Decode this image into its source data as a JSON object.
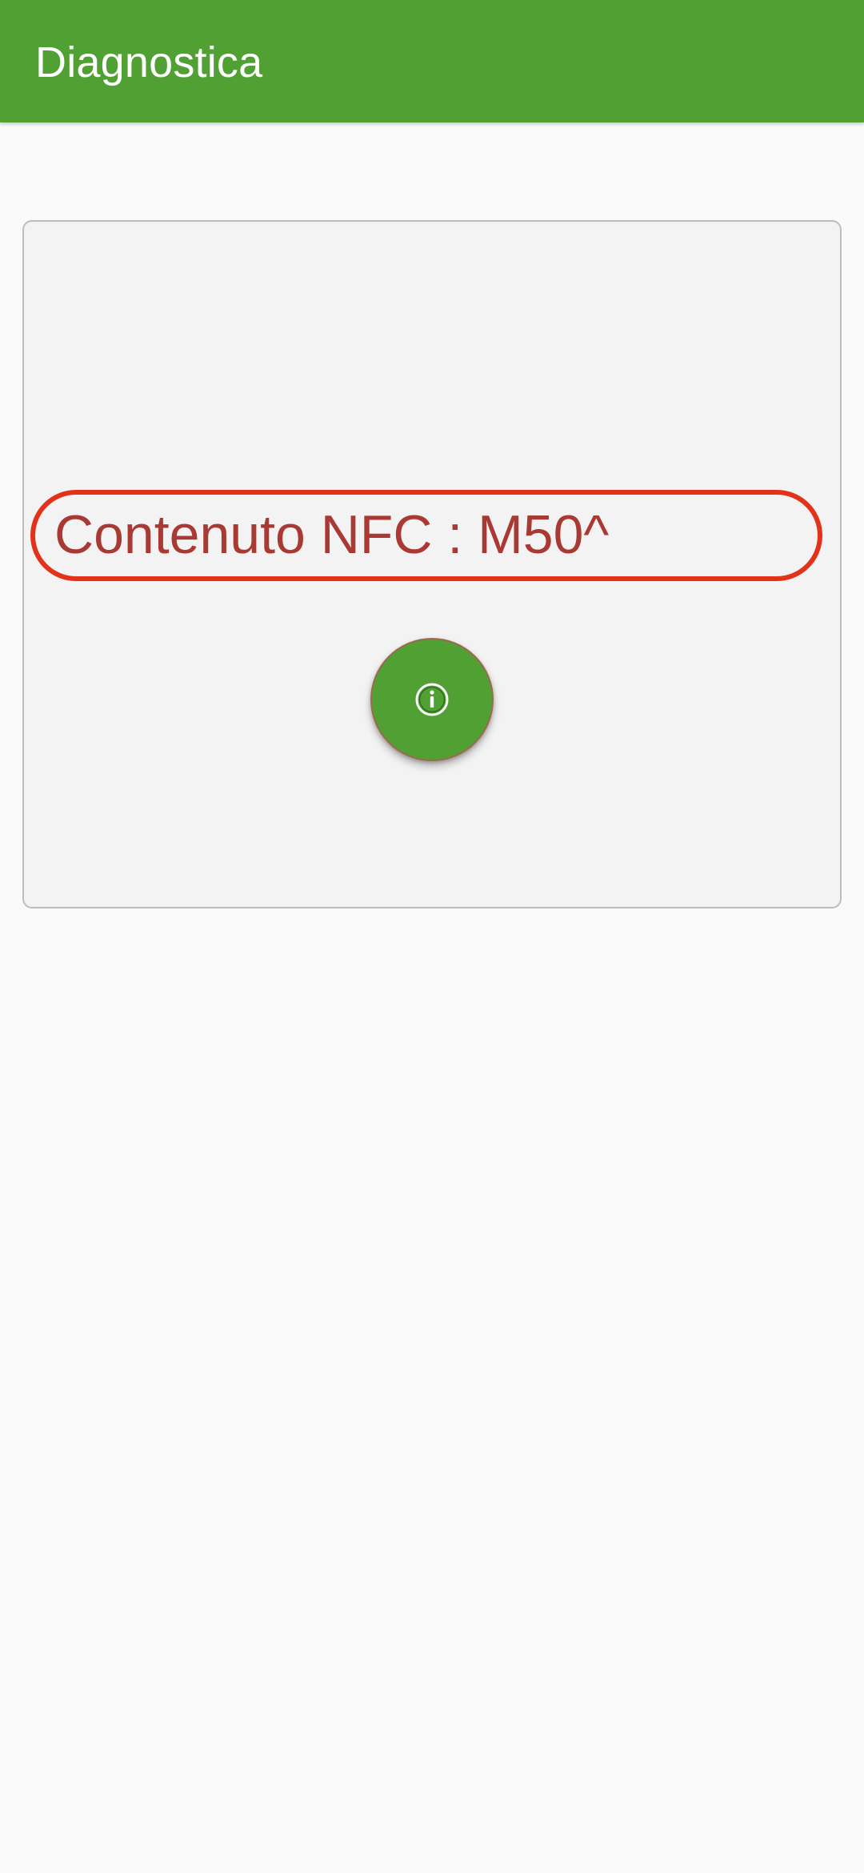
{
  "app_bar": {
    "title": "Diagnostica",
    "color": "#51a034"
  },
  "card": {
    "nfc_label": "Contenuto NFC : M50^",
    "highlight_color": "#e2321a",
    "text_color": "#a83a33"
  },
  "fab": {
    "icon": "info-icon",
    "color": "#51a034"
  }
}
